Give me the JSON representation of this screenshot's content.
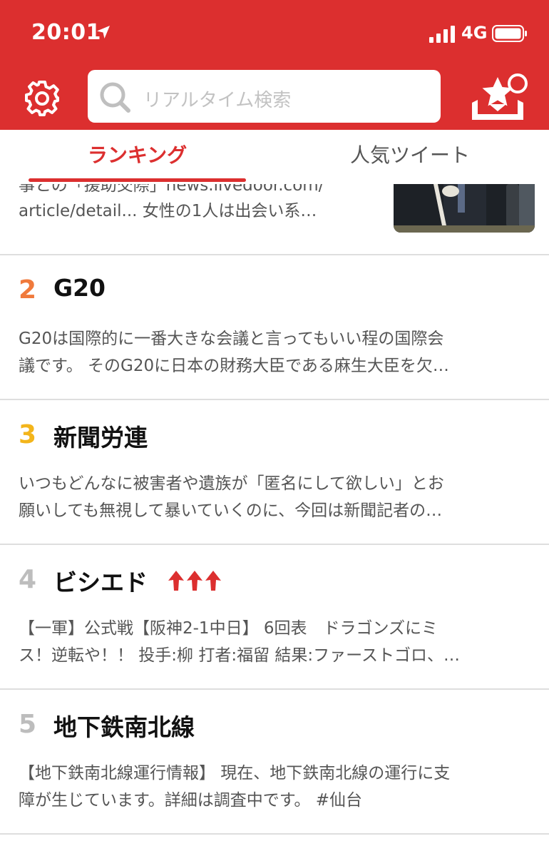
{
  "status_bar": {
    "time": "20:01",
    "network": "4G"
  },
  "header": {
    "search_placeholder": "リアルタイム検索",
    "colors": {
      "brand": "#dc2f2f",
      "white": "#ffffff"
    }
  },
  "tabs": [
    {
      "label": "ランキング",
      "active": true
    },
    {
      "label": "人気ツイート",
      "active": false
    }
  ],
  "ranking": {
    "item1": {
      "partial_line": "事との「援助交際」news.livedoor.com/",
      "line": "article/detail...  女性の1人は出会い系…"
    },
    "items": [
      {
        "rank": "2",
        "rank_color": "#f07a3c",
        "title": "G20",
        "snippet": [
          "G20は国際的に一番大きな会議と言ってもいい程の国際会",
          "議です。 そのG20に日本の財務大臣である麻生大臣を欠…"
        ]
      },
      {
        "rank": "3",
        "rank_color": "#f3b51b",
        "title": "新聞労連",
        "snippet": [
          "いつもどんなに被害者や遺族が「匿名にして欲しい」とお",
          "願いしても無視して暴いていくのに、今回は新聞記者の…"
        ]
      },
      {
        "rank": "4",
        "rank_color": "#bdbdbd",
        "title": "ビシエド",
        "trend": "rising",
        "snippet": [
          "【一軍】公式戦【阪神2-1中日】 6回表　ドラゴンズにミ",
          "ス！逆転や！！ 投手:柳 打者:福留 結果:ファーストゴロ、…"
        ]
      },
      {
        "rank": "5",
        "rank_color": "#bdbdbd",
        "title": "地下鉄南北線",
        "snippet": [
          "【地下鉄南北線運行情報】 現在、地下鉄南北線の運行に支",
          "障が生じています。詳細は調査中です。 #仙台"
        ]
      }
    ]
  }
}
